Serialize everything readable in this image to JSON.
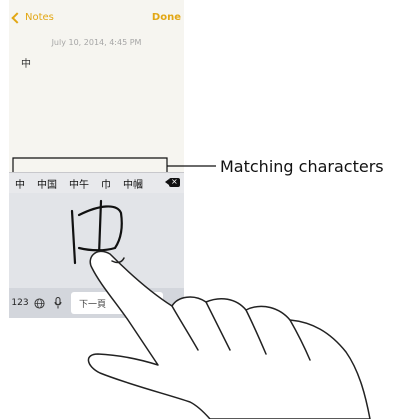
{
  "nav": {
    "back_label": "Notes",
    "done_label": "Done"
  },
  "note": {
    "date": "July 10, 2014, 4:45 PM",
    "content": "中"
  },
  "candidates": [
    "中",
    "中国",
    "中午",
    "巾",
    "中幗"
  ],
  "keyboard": {
    "numbers_label": "123",
    "space_label": "下一頁"
  },
  "callout": {
    "label": "Matching characters"
  },
  "colors": {
    "accent": "#e2a714"
  }
}
